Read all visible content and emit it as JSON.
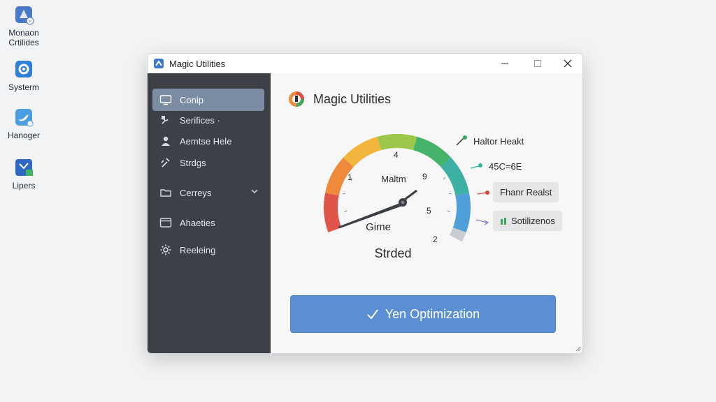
{
  "desktop": {
    "icons": [
      {
        "label_line1": "Monaon",
        "label_line2": "Crtilides",
        "icon": "app-tile-icon"
      },
      {
        "label_line1": "Systerm",
        "label_line2": "",
        "icon": "gear-tile-icon"
      },
      {
        "label_line1": "Hanoger",
        "label_line2": "",
        "icon": "bird-tile-icon"
      },
      {
        "label_line1": "Lipers",
        "label_line2": "",
        "icon": "chart-tile-icon"
      }
    ]
  },
  "window": {
    "title": "Magic Utilities",
    "controls": {
      "minimize": "minimize-icon",
      "maximize": "maximize-icon",
      "close": "close-icon"
    }
  },
  "sidebar": {
    "items": [
      {
        "label": "Conip",
        "icon": "monitor-icon",
        "active": true
      },
      {
        "label": "Serifices ·",
        "icon": "tools-icon",
        "active": false
      },
      {
        "label": "Aemtse Hele",
        "icon": "user-icon",
        "active": false
      },
      {
        "label": "Strdgs",
        "icon": "wrench-icon",
        "active": false
      },
      {
        "label": "Cerreys",
        "icon": "folder-icon",
        "active": false,
        "has_chevron": true
      },
      {
        "label": "Ahaeties",
        "icon": "window-icon",
        "active": false
      },
      {
        "label": "Reeleing",
        "icon": "settings-icon",
        "active": false
      }
    ]
  },
  "main": {
    "title": "Magic Utilities",
    "gauge": {
      "center_label": "Maltm",
      "lower_label": "Gime",
      "status": "Strded",
      "ticks": [
        "1",
        "4",
        "9",
        "5",
        "2"
      ],
      "colors": [
        "#e0544a",
        "#ef8a3a",
        "#f3b63c",
        "#9dc64a",
        "#45b36a",
        "#3bb0a3",
        "#4e9fd8"
      ]
    },
    "metrics": [
      {
        "text": "Haltor Heakt",
        "dot_color": "#3aa55b"
      },
      {
        "text": "45C=6E",
        "dot_color": "#2fb39b"
      },
      {
        "text": "Fhanr Realst",
        "dot_color": "#d8473f"
      },
      {
        "text": "Sotilizenos",
        "dot_color": "#8a7bd1",
        "prefix_icon": "bars-icon"
      }
    ],
    "cta_label": "Yen Optimization"
  }
}
